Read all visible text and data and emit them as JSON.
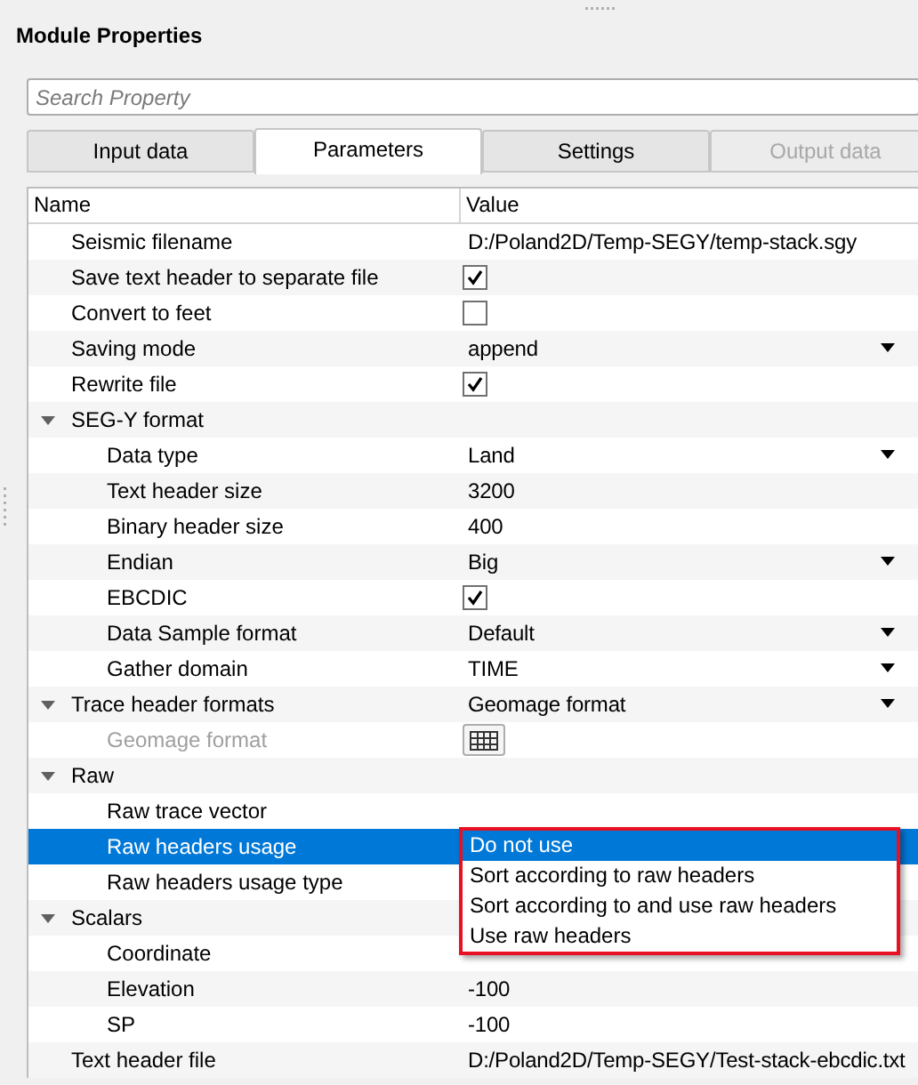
{
  "panel": {
    "title": "Module Properties"
  },
  "search": {
    "placeholder": "Search Property"
  },
  "tabs": [
    {
      "label": "Input data",
      "selected": false,
      "disabled": false
    },
    {
      "label": "Parameters",
      "selected": true,
      "disabled": false
    },
    {
      "label": "Settings",
      "selected": false,
      "disabled": false
    },
    {
      "label": "Output data",
      "selected": false,
      "disabled": true
    }
  ],
  "table": {
    "columns": [
      "Name",
      "Value"
    ],
    "rows": [
      {
        "name": "Seismic filename",
        "kind": "text",
        "value": "D:/Poland2D/Temp-SEGY/temp-stack.sgy"
      },
      {
        "name": "Save text header to separate file",
        "kind": "checkbox",
        "checked": true
      },
      {
        "name": "Convert to feet",
        "kind": "checkbox",
        "checked": false
      },
      {
        "name": "Saving mode",
        "kind": "dropdown",
        "value": "append"
      },
      {
        "name": "Rewrite file",
        "kind": "checkbox",
        "checked": true
      },
      {
        "name": "SEG-Y format",
        "kind": "group",
        "expanded": true,
        "children": [
          {
            "name": "Data type",
            "kind": "dropdown",
            "value": "Land"
          },
          {
            "name": "Text header size",
            "kind": "text",
            "value": "3200"
          },
          {
            "name": "Binary header size",
            "kind": "text",
            "value": "400"
          },
          {
            "name": "Endian",
            "kind": "dropdown",
            "value": "Big"
          },
          {
            "name": "EBCDIC",
            "kind": "checkbox",
            "checked": true
          },
          {
            "name": "Data Sample format",
            "kind": "dropdown",
            "value": "Default"
          },
          {
            "name": "Gather domain",
            "kind": "dropdown",
            "value": "TIME"
          }
        ]
      },
      {
        "name": "Trace header formats",
        "kind": "group",
        "expanded": true,
        "value": "Geomage format",
        "children": [
          {
            "name": "Geomage format",
            "kind": "table-button",
            "disabled": true
          }
        ]
      },
      {
        "name": "Raw",
        "kind": "group",
        "expanded": true,
        "children": [
          {
            "name": "Raw trace vector",
            "kind": "empty"
          },
          {
            "name": "Raw headers usage",
            "kind": "empty",
            "selected": true,
            "options": [
              {
                "label": "Do not use",
                "selected": true
              },
              {
                "label": "Sort according to raw headers",
                "selected": false
              },
              {
                "label": "Sort according to and use raw headers",
                "selected": false
              },
              {
                "label": "Use raw headers",
                "selected": false
              }
            ]
          },
          {
            "name": "Raw headers usage type",
            "kind": "empty"
          }
        ]
      },
      {
        "name": "Scalars",
        "kind": "group",
        "expanded": true,
        "children": [
          {
            "name": "Coordinate",
            "kind": "empty"
          },
          {
            "name": "Elevation",
            "kind": "text",
            "value": "-100"
          },
          {
            "name": "SP",
            "kind": "text",
            "value": "-100"
          }
        ]
      },
      {
        "name": "Text header file",
        "kind": "text",
        "value": "D:/Poland2D/Temp-SEGY/Test-stack-ebcdic.txt"
      }
    ]
  }
}
